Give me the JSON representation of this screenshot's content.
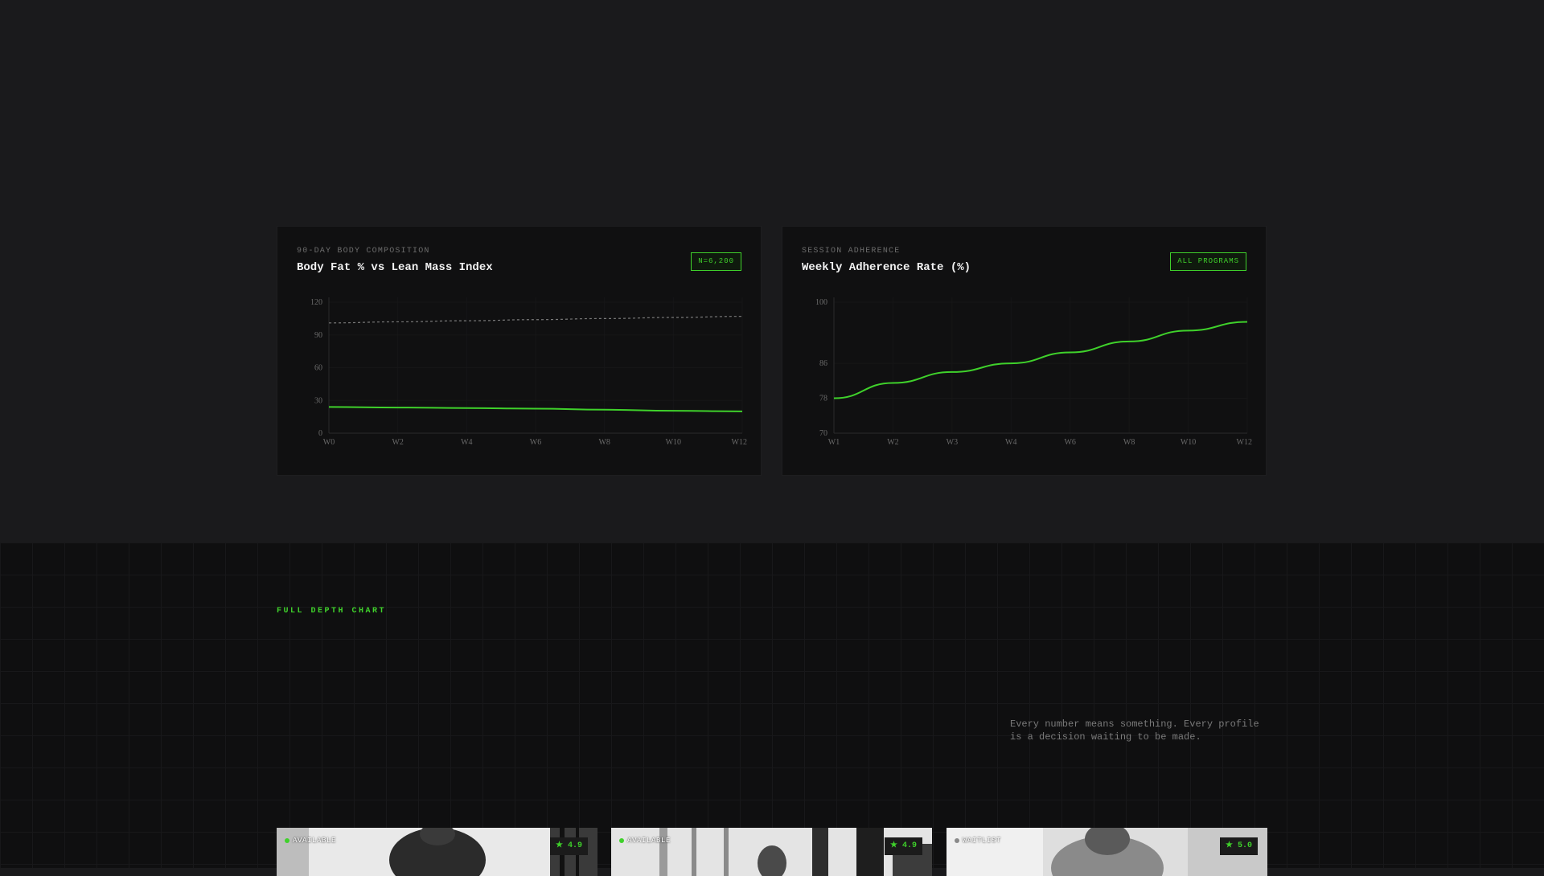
{
  "panels": {
    "left": {
      "kicker": "90-DAY BODY COMPOSITION",
      "title": "Body Fat % vs Lean Mass Index",
      "badge": "N=6,200"
    },
    "right": {
      "kicker": "SESSION ADHERENCE",
      "title": "Weekly Adherence Rate (%)",
      "badge": "ALL PROGRAMS"
    }
  },
  "chart_data": [
    {
      "type": "line",
      "title": "Body Fat % vs Lean Mass Index",
      "x": [
        "W0",
        "W2",
        "W4",
        "W6",
        "W8",
        "W10",
        "W12"
      ],
      "yticks": [
        0,
        30,
        60,
        90,
        120
      ],
      "ylim": [
        0,
        120
      ],
      "series": [
        {
          "values": [
            101,
            102,
            103,
            104,
            105,
            106,
            107
          ],
          "color": "#7a7a7a",
          "style": "dashed"
        },
        {
          "values": [
            24,
            23.5,
            23,
            22.5,
            21.5,
            20.5,
            20
          ],
          "color": "#3fd12b",
          "style": "solid"
        }
      ]
    },
    {
      "type": "line",
      "title": "Weekly Adherence Rate (%)",
      "x": [
        "W1",
        "W2",
        "W3",
        "W4",
        "W6",
        "W8",
        "W10",
        "W12"
      ],
      "yticks": [
        70,
        78,
        86,
        100
      ],
      "ylim": [
        70,
        100
      ],
      "series": [
        {
          "values": [
            78,
            81.5,
            84,
            86,
            88.5,
            91,
            93.5,
            95.5
          ],
          "color": "#3fd12b",
          "style": "solid"
        }
      ]
    }
  ],
  "section": {
    "eyebrow": "FULL DEPTH CHART",
    "tagline": "Every number means something. Every profile is a decision waiting to be made."
  },
  "cards": [
    {
      "status": "AVAILABLE",
      "rating": "★ 4.9"
    },
    {
      "status": "AVAILABLE",
      "rating": "★ 4.9"
    },
    {
      "status": "WAITLIST",
      "rating": "★ 5.0"
    }
  ],
  "colors": {
    "accent": "#3fd12b",
    "background": "#1a1a1c",
    "panel": "#101011"
  }
}
